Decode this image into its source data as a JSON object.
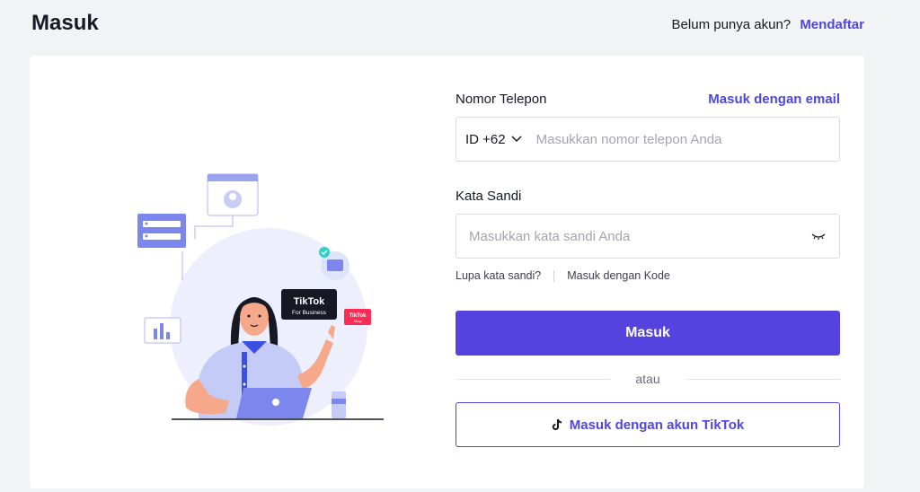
{
  "header": {
    "title": "Masuk",
    "no_account_text": "Belum punya akun?",
    "signup_link": "Mendaftar"
  },
  "illustration": {
    "badge_main": "TikTok",
    "badge_sub": "For Business",
    "badge_small": "TikTok",
    "badge_small_sub": "Shop"
  },
  "form": {
    "phone_label": "Nomor Telepon",
    "email_link": "Masuk dengan email",
    "country_code": "ID +62",
    "phone_placeholder": "Masukkan nomor telepon Anda",
    "password_label": "Kata Sandi",
    "password_placeholder": "Masukkan kata sandi Anda",
    "forgot_password": "Lupa kata sandi?",
    "login_with_code": "Masuk dengan Kode",
    "submit_label": "Masuk",
    "divider_text": "atau",
    "tiktok_login_label": "Masuk dengan akun TikTok"
  },
  "colors": {
    "accent": "#5543e0",
    "link": "#4f46e5",
    "background": "#f2f3f5"
  }
}
